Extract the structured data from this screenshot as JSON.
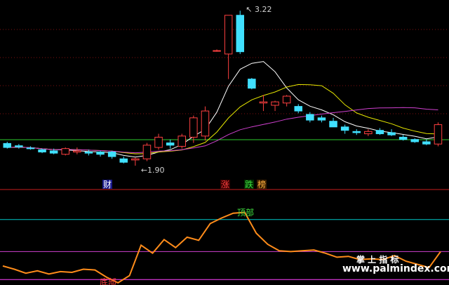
{
  "chart_data": [
    {
      "type": "candlestick",
      "ylim": [
        1.74,
        3.28
      ],
      "candles": [
        [
          2.095,
          2.11,
          2.05,
          2.06
        ],
        [
          2.075,
          2.09,
          2.05,
          2.065
        ],
        [
          2.055,
          2.07,
          2.04,
          2.05
        ],
        [
          2.04,
          2.05,
          2.01,
          2.02
        ],
        [
          2.03,
          2.05,
          2.0,
          2.01
        ],
        [
          2.0,
          2.06,
          1.99,
          2.05
        ],
        [
          2.02,
          2.06,
          2.0,
          2.03
        ],
        [
          2.02,
          2.04,
          1.99,
          2.01
        ],
        [
          2.02,
          2.03,
          1.98,
          2.0
        ],
        [
          2.02,
          2.03,
          1.96,
          1.98
        ],
        [
          1.96,
          1.98,
          1.92,
          1.93
        ],
        [
          1.95,
          1.97,
          1.9,
          1.96
        ],
        [
          1.96,
          2.1,
          1.94,
          2.08
        ],
        [
          2.06,
          2.18,
          2.04,
          2.15
        ],
        [
          2.1,
          2.13,
          2.05,
          2.08
        ],
        [
          2.07,
          2.18,
          2.05,
          2.16
        ],
        [
          2.15,
          2.34,
          2.1,
          2.32
        ],
        [
          2.16,
          2.42,
          2.12,
          2.38
        ],
        [
          2.91,
          2.92,
          2.9,
          2.91
        ],
        [
          2.88,
          3.22,
          2.66,
          3.22
        ],
        [
          3.22,
          3.26,
          2.88,
          2.9
        ],
        [
          2.66,
          2.67,
          2.57,
          2.58
        ],
        [
          2.45,
          2.52,
          2.38,
          2.46
        ],
        [
          2.43,
          2.47,
          2.38,
          2.46
        ],
        [
          2.45,
          2.52,
          2.42,
          2.51
        ],
        [
          2.42,
          2.44,
          2.36,
          2.38
        ],
        [
          2.35,
          2.37,
          2.28,
          2.3
        ],
        [
          2.32,
          2.34,
          2.28,
          2.3
        ],
        [
          2.29,
          2.32,
          2.24,
          2.24
        ],
        [
          2.24,
          2.26,
          2.18,
          2.21
        ],
        [
          2.2,
          2.22,
          2.17,
          2.19
        ],
        [
          2.18,
          2.22,
          2.16,
          2.2
        ],
        [
          2.21,
          2.23,
          2.17,
          2.18
        ],
        [
          2.19,
          2.22,
          2.16,
          2.17
        ],
        [
          2.15,
          2.17,
          2.12,
          2.13
        ],
        [
          2.13,
          2.14,
          2.1,
          2.11
        ],
        [
          2.11,
          2.13,
          2.08,
          2.09
        ],
        [
          2.09,
          2.28,
          2.07,
          2.26
        ]
      ],
      "annotations": [
        {
          "text": "3.22",
          "price": 3.22
        },
        {
          "text": "1.90",
          "price": 1.9
        }
      ],
      "markers": [
        "财",
        "涨",
        "跌",
        "榜"
      ]
    },
    {
      "type": "line",
      "labels": [
        "顶部",
        "底部"
      ],
      "ylim": [
        0,
        100
      ],
      "levels": [
        {
          "value": 80,
          "color": "#00c8c8"
        },
        {
          "value": 40,
          "color": "#d040d0"
        },
        {
          "value": 5,
          "color": "#ff40ff"
        }
      ],
      "series": [
        {
          "color": "#ff8c1a",
          "values": [
            22,
            18,
            13,
            16,
            12,
            15,
            14,
            18,
            17,
            8,
            1,
            10,
            48,
            38,
            55,
            45,
            58,
            54,
            75,
            82,
            88,
            89,
            63,
            49,
            41,
            40,
            41,
            42,
            38,
            33,
            34,
            30,
            31,
            30,
            35,
            28,
            24,
            20,
            40
          ]
        }
      ]
    }
  ],
  "watermark": {
    "line1": "掌 上 指 标",
    "line2": "www.palmindex.com"
  }
}
